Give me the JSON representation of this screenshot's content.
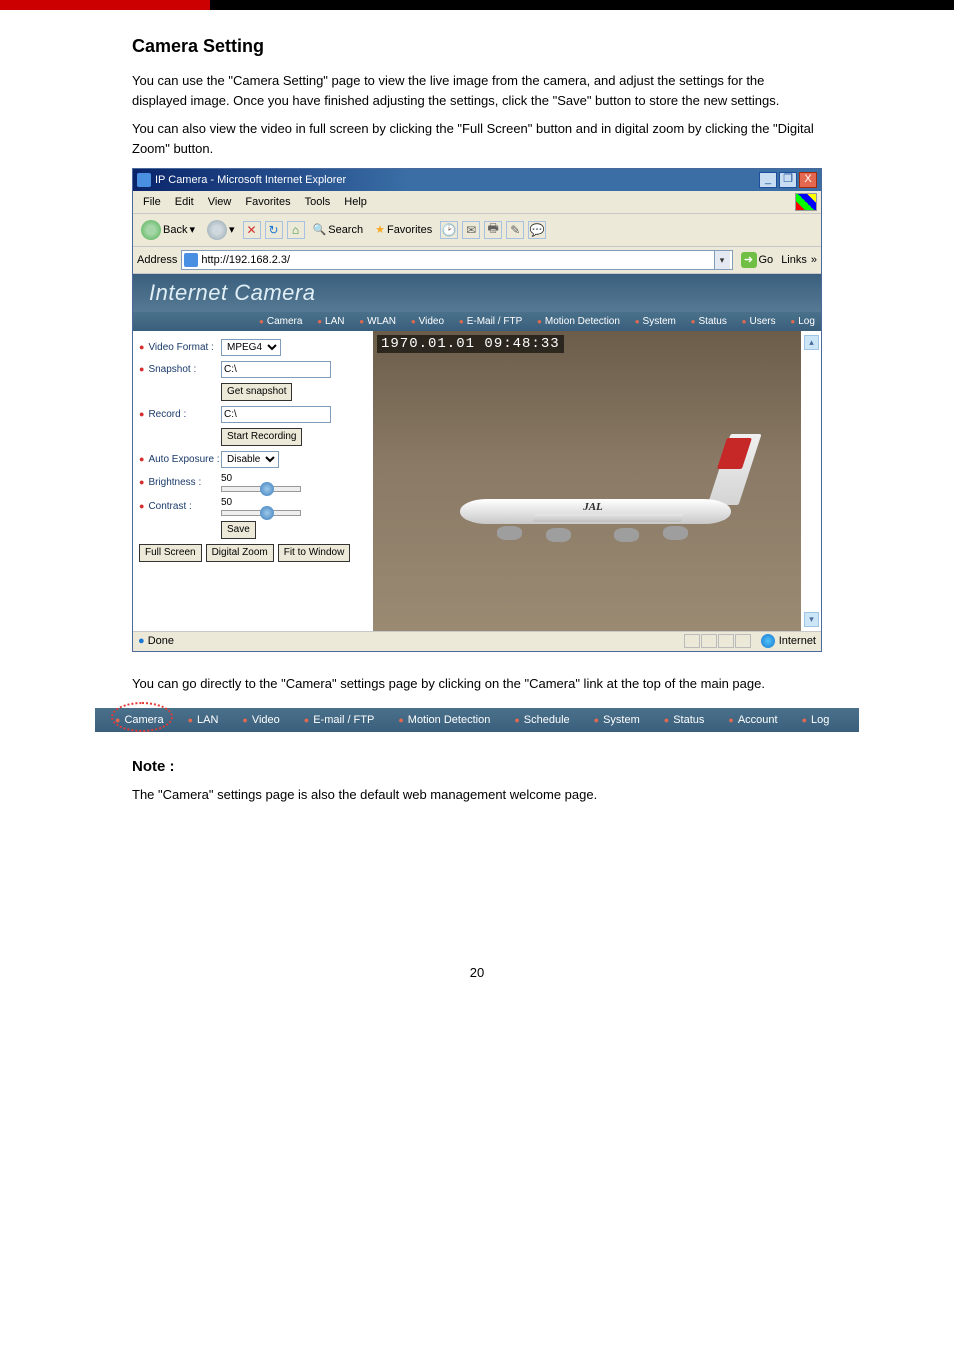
{
  "page": {
    "number": "20"
  },
  "top_section": {
    "heading": "Camera Setting",
    "p1": "You can use the \"Camera Setting\" page to view the live image from the camera, and adjust the settings for the displayed image. Once you have finished adjusting the settings, click the \"Save\" button to store the new settings.",
    "p2": "You can also view the video in full screen by clicking the \"Full Screen\" button and in digital zoom by clicking the \"Digital Zoom\" button."
  },
  "ie_window": {
    "title": "IP Camera - Microsoft Internet Explorer",
    "menu": [
      "File",
      "Edit",
      "View",
      "Favorites",
      "Tools",
      "Help"
    ],
    "win_min": "_",
    "win_max": "❐",
    "win_close": "X",
    "toolbar": {
      "back": "Back",
      "search": "Search",
      "favorites": "Favorites"
    },
    "address_label": "Address",
    "url": "http://192.168.2.3/",
    "go": "Go",
    "links": "Links",
    "status_done": "Done",
    "status_zone": "Internet"
  },
  "camera_app": {
    "header": "Internet Camera",
    "nav": [
      "Camera",
      "LAN",
      "WLAN",
      "Video",
      "E-Mail / FTP",
      "Motion Detection",
      "System",
      "Status",
      "Users",
      "Log"
    ],
    "timestamp": "1970.01.01 09:48:33",
    "plane_text": "JAL",
    "labels": {
      "video_format": "Video Format :",
      "snapshot": "Snapshot :",
      "record": "Record :",
      "auto_exposure": "Auto Exposure :",
      "brightness": "Brightness :",
      "contrast": "Contrast :"
    },
    "values": {
      "video_format_sel": "MPEG4",
      "snapshot_path": "C:\\",
      "get_snapshot": "Get snapshot",
      "record_path": "C:\\",
      "start_recording": "Start Recording",
      "auto_exposure_sel": "Disable",
      "brightness_val": "50",
      "contrast_val": "50",
      "save": "Save",
      "full_screen": "Full Screen",
      "digital_zoom": "Digital Zoom",
      "fit_to_window": "Fit to Window"
    }
  },
  "nav_strip": {
    "items": [
      "Camera",
      "LAN",
      "Video",
      "E-mail / FTP",
      "Motion Detection",
      "Schedule",
      "System",
      "Status",
      "Account",
      "Log"
    ]
  },
  "notes": {
    "heading": "Note :",
    "body": "The \"Camera\" settings page is also the default web management welcome page."
  }
}
